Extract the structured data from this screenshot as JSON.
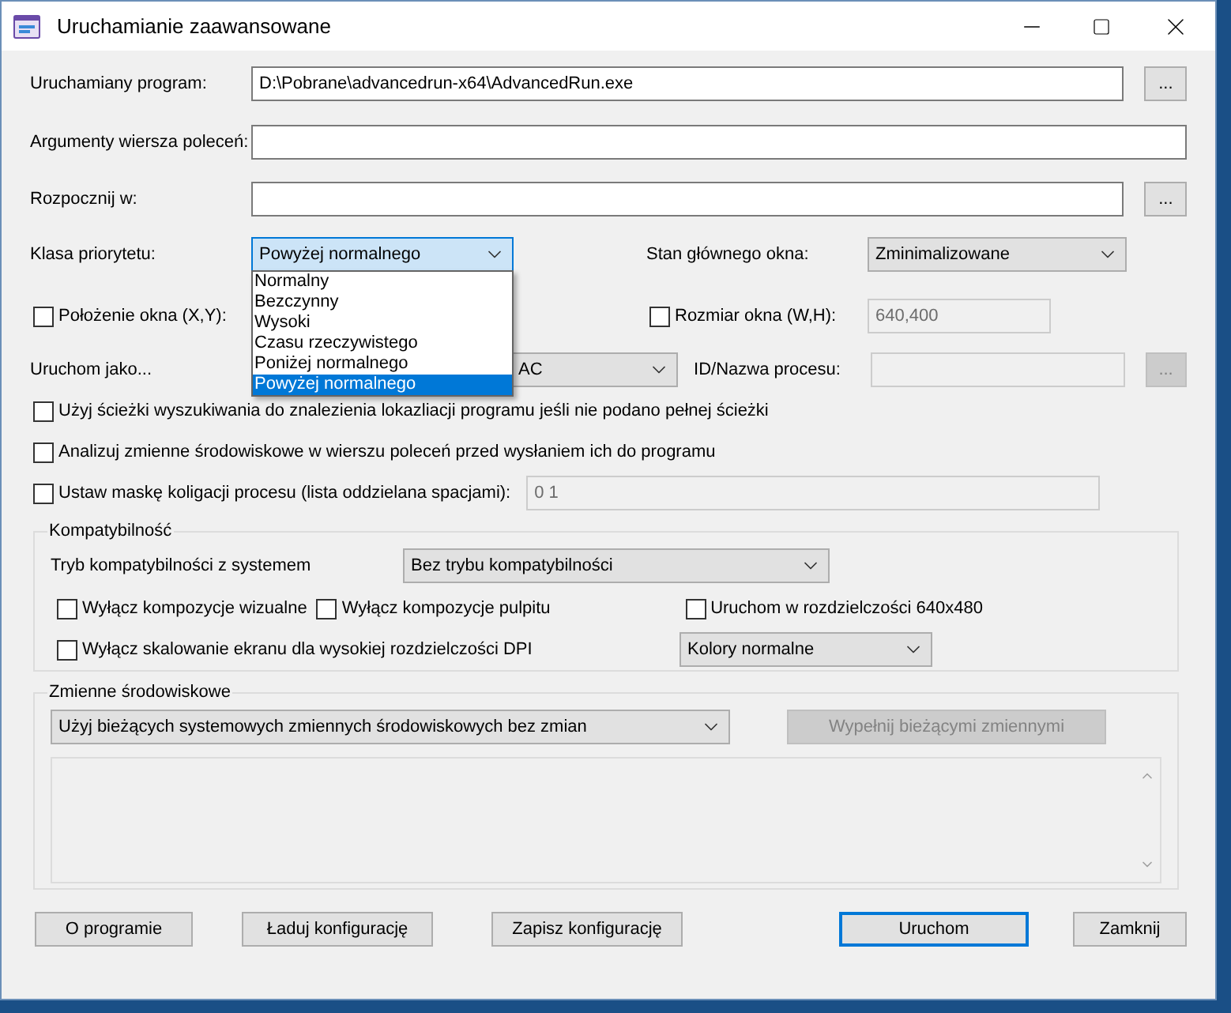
{
  "window": {
    "title": "Uruchamianie zaawansowane"
  },
  "program": {
    "label": "Uruchamiany program:",
    "value": "D:\\Pobrane\\advancedrun-x64\\AdvancedRun.exe",
    "browse": "..."
  },
  "arguments": {
    "label": "Argumenty wiersza poleceń:"
  },
  "start_in": {
    "label": "Rozpocznij w:",
    "browse": "..."
  },
  "priority": {
    "label": "Klasa priorytetu:",
    "value": "Powyżej normalnego",
    "open": true,
    "options": [
      {
        "label": "Normalny",
        "selected": false
      },
      {
        "label": "Bezczynny",
        "selected": false
      },
      {
        "label": "Wysoki",
        "selected": false
      },
      {
        "label": "Czasu rzeczywistego",
        "selected": false
      },
      {
        "label": "Poniżej normalnego",
        "selected": false
      },
      {
        "label": "Powyżej normalnego",
        "selected": true
      }
    ]
  },
  "window_state": {
    "label": "Stan głównego okna:",
    "value": "Zminimalizowane"
  },
  "window_position": {
    "label": "Położenie okna (X,Y):",
    "checked": false
  },
  "window_size": {
    "label": "Rozmiar okna (W,H):",
    "checked": false,
    "value": "640,400",
    "disabled": true
  },
  "run_as": {
    "label": "Uruchom jako...",
    "value": "AC"
  },
  "process_id": {
    "label": "ID/Nazwa procesu:",
    "disabled": true,
    "browse": "..."
  },
  "options": [
    {
      "kind": "checkbox",
      "label": "Użyj ścieżki wyszukiwania do znalezienia lokazliacji programu jeśli nie podano pełnej ścieżki",
      "checked": false
    },
    {
      "kind": "checkbox",
      "label": "Analizuj zmienne środowiskowe w wierszu poleceń przed wysłaniem ich do programu",
      "checked": false
    },
    {
      "kind": "checkbox-field",
      "label": "Ustaw maskę koligacji procesu (lista oddzielana spacjami):",
      "checked": false,
      "value": "0 1"
    }
  ],
  "compatibility": {
    "title": "Kompatybilność",
    "mode_label": "Tryb kompatybilności z systemem",
    "mode_value": "Bez trybu kompatybilności",
    "checks": [
      {
        "label": "Wyłącz kompozycje wizualne",
        "checked": false
      },
      {
        "label": "Wyłącz kompozycje pulpitu",
        "checked": false
      },
      {
        "label": "Uruchom w rozdzielczości 640x480",
        "checked": false
      },
      {
        "label": "Wyłącz skalowanie ekranu dla wysokiej rozdzielczości DPI",
        "checked": false
      }
    ],
    "colors_value": "Kolory normalne"
  },
  "environment": {
    "title": "Zmienne środowiskowe",
    "mode_value": "Użyj bieżących systemowych zmiennych środowiskowych bez zmian",
    "fill_button": {
      "label": "Wypełnij bieżącymi zmiennymi",
      "disabled": true
    }
  },
  "buttons": [
    {
      "label": "O programie",
      "default": false
    },
    {
      "label": "Ładuj konfigurację",
      "default": false
    },
    {
      "label": "Zapisz konfigurację",
      "default": false
    },
    {
      "label": "Uruchom",
      "default": true
    },
    {
      "label": "Zamknij",
      "default": false
    }
  ]
}
